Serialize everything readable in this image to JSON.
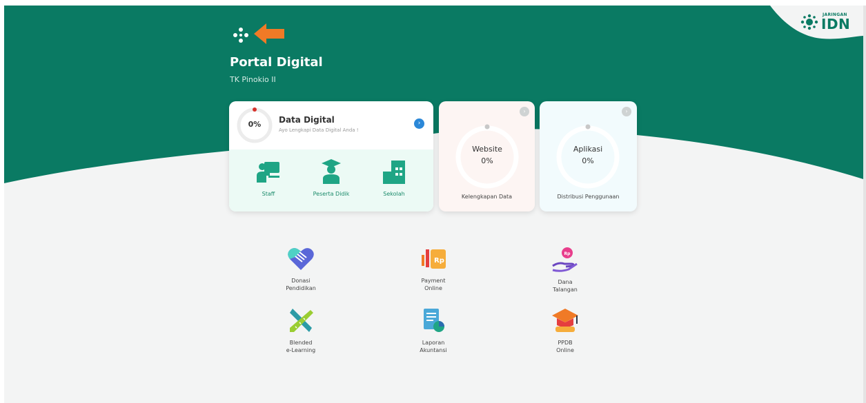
{
  "colors": {
    "brand_green": "#0a7a63",
    "accent_orange": "#f07a26",
    "background": "#f3f4f4"
  },
  "header": {
    "title": "Portal Digital",
    "subtitle": "TK Pinokio II",
    "logo_small": "JARINGAN",
    "logo_big": "IDN"
  },
  "data_digital": {
    "progress": "0%",
    "title": "Data Digital",
    "subtitle": "Ayo Lengkapi Data Digital Anda !",
    "items": [
      {
        "label": "Staff",
        "icon": "teacher-icon"
      },
      {
        "label": "Peserta Didik",
        "icon": "student-icon"
      },
      {
        "label": "Sekolah",
        "icon": "school-building-icon"
      }
    ]
  },
  "website_card": {
    "ring_title": "Website",
    "ring_value": "0%",
    "footer": "Kelengkapan Data"
  },
  "aplikasi_card": {
    "ring_title": "Aplikasi",
    "ring_value": "0%",
    "footer": "Distribusi Penggunaan"
  },
  "services": [
    {
      "line1": "Donasi",
      "line2": "Pendidikan",
      "icon": "heart-handshake-icon"
    },
    {
      "line1": "Payment",
      "line2": "Online",
      "icon": "payment-rp-icon"
    },
    {
      "line1": "Dana",
      "line2": "Talangan",
      "icon": "hand-coin-icon"
    },
    {
      "line1": "Blended",
      "line2": "e-Learning",
      "icon": "ruler-pencil-icon"
    },
    {
      "line1": "Laporan",
      "line2": "Akuntansi",
      "icon": "report-chart-icon"
    },
    {
      "line1": "PPDB",
      "line2": "Online",
      "icon": "graduation-cap-icon"
    }
  ]
}
